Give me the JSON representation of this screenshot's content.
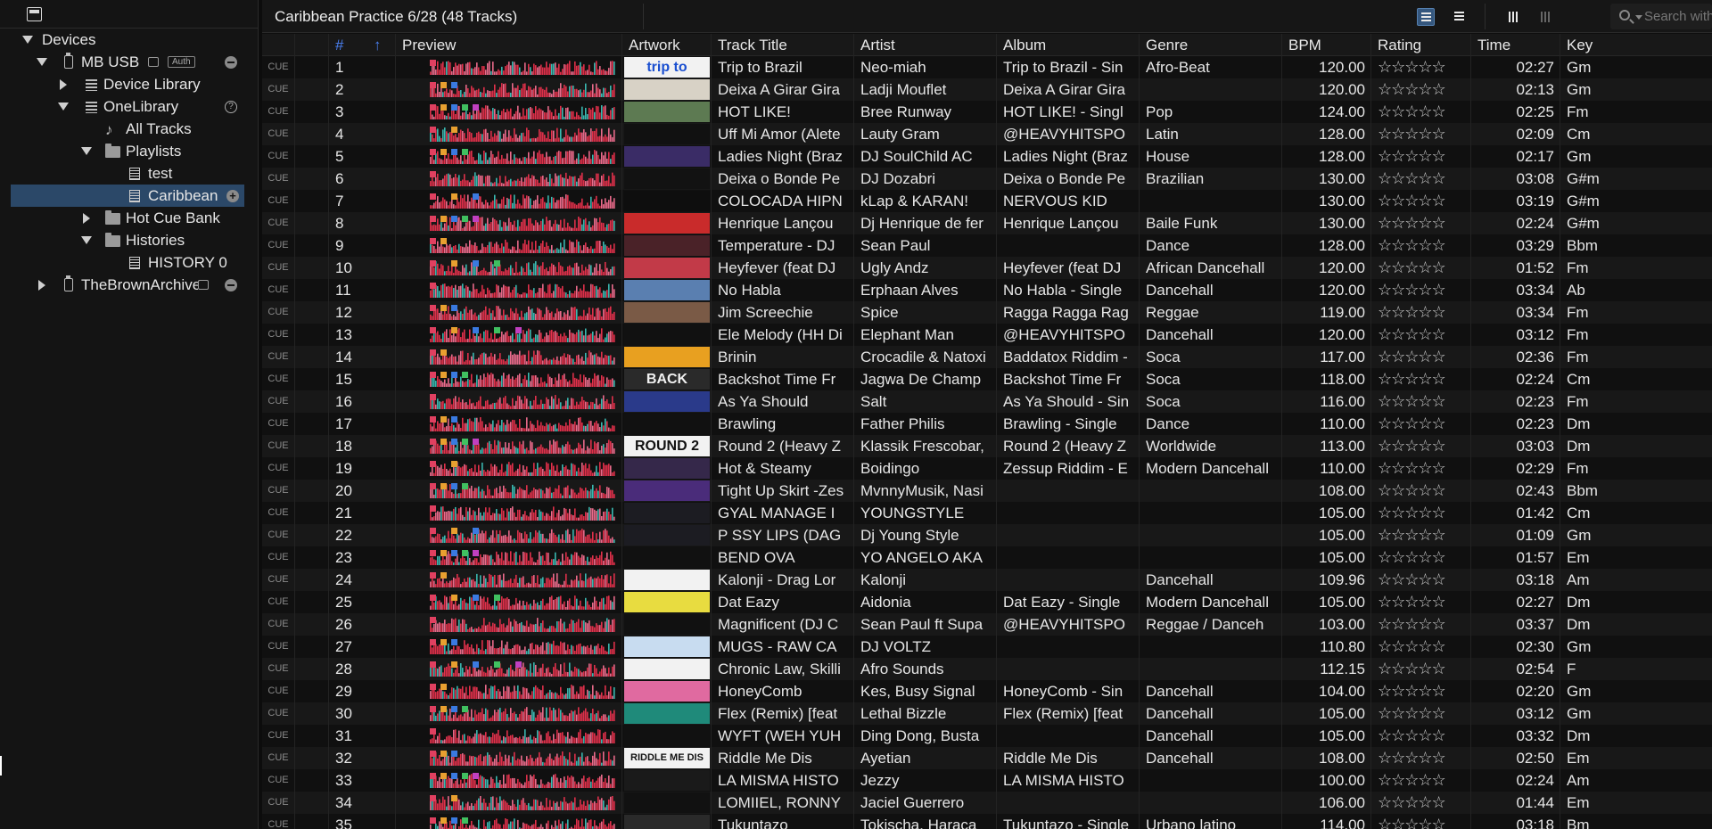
{
  "sidebar": {
    "devices": "Devices",
    "mb_usb": "MB USB",
    "auth": "Auth",
    "device_library": "Device Library",
    "onelibrary": "OneLibrary",
    "all_tracks": "All Tracks",
    "playlists": "Playlists",
    "test": "test",
    "caribbean": "Caribbean",
    "hot_cue_bank": "Hot Cue Bank",
    "histories": "Histories",
    "history0": "HISTORY 0",
    "brown_archive": "TheBrownArchive"
  },
  "header": {
    "title": "Caribbean Practice 6/28 (48 Tracks)",
    "search_placeholder": "Search with"
  },
  "columns": {
    "num": "#",
    "preview": "Preview",
    "artwork": "Artwork",
    "title": "Track Title",
    "artist": "Artist",
    "album": "Album",
    "genre": "Genre",
    "bpm": "BPM",
    "rating": "Rating",
    "time": "Time",
    "key": "Key"
  },
  "cue_label": "CUE",
  "rating_glyphs": "☆☆☆☆☆",
  "tracks": [
    {
      "n": "1",
      "title": "Trip to Brazil",
      "artist": "Neo-miah",
      "album": "Trip to Brazil - Sin",
      "genre": "Afro-Beat",
      "bpm": "120.00",
      "time": "02:27",
      "key": "Gm",
      "art": "trip to",
      "artbg": "#f2f2f2",
      "artfg": "#1a4fd0"
    },
    {
      "n": "2",
      "title": "Deixa A Girar Gira",
      "artist": "Ladji Mouflet",
      "album": "Deixa A Girar Gira",
      "genre": "",
      "bpm": "120.00",
      "time": "02:13",
      "key": "Gm",
      "art": "",
      "artbg": "#d8d2c6",
      "artfg": "#333"
    },
    {
      "n": "3",
      "title": "HOT LIKE!",
      "artist": "Bree Runway",
      "album": "HOT LIKE! - Singl",
      "genre": "Pop",
      "bpm": "124.00",
      "time": "02:25",
      "key": "Fm",
      "art": "",
      "artbg": "#5d7a52",
      "artfg": "#fff"
    },
    {
      "n": "4",
      "title": "Uff Mi Amor (Alete",
      "artist": "Lauty Gram",
      "album": "@HEAVYHITSPO",
      "genre": "Latin",
      "bpm": "128.00",
      "time": "02:09",
      "key": "Cm",
      "art": "",
      "artbg": "#111",
      "artfg": "#e03a8a"
    },
    {
      "n": "5",
      "title": "Ladies Night (Braz",
      "artist": "DJ SoulChild AC",
      "album": "Ladies Night (Braz",
      "genre": "House",
      "bpm": "128.00",
      "time": "02:17",
      "key": "Gm",
      "art": "",
      "artbg": "#3a2c66",
      "artfg": "#fff"
    },
    {
      "n": "6",
      "title": "Deixa o Bonde Pe",
      "artist": "DJ Dozabri",
      "album": "Deixa o Bonde Pe",
      "genre": "Brazilian",
      "bpm": "130.00",
      "time": "03:08",
      "key": "G#m",
      "art": "",
      "artbg": "#121212",
      "artfg": "#e03a8a"
    },
    {
      "n": "7",
      "title": "COLOCADA HIPN",
      "artist": "kLap & KARAN!",
      "album": "NERVOUS KID",
      "genre": "",
      "bpm": "130.00",
      "time": "03:19",
      "key": "G#m",
      "art": "",
      "artbg": "#0e0e0e",
      "artfg": "#fff"
    },
    {
      "n": "8",
      "title": "Henrique Lançou",
      "artist": "Dj Henrique de fer",
      "album": "Henrique Lançou",
      "genre": "Baile Funk",
      "bpm": "130.00",
      "time": "02:24",
      "key": "G#m",
      "art": "",
      "artbg": "#c92b2b",
      "artfg": "#fff"
    },
    {
      "n": "9",
      "title": "Temperature - DJ",
      "artist": "Sean Paul",
      "album": "",
      "genre": "Dance",
      "bpm": "128.00",
      "time": "03:29",
      "key": "Bbm",
      "art": "",
      "artbg": "#4a2228",
      "artfg": "#fff"
    },
    {
      "n": "10",
      "title": "Heyfever (feat DJ",
      "artist": "Ugly Andz",
      "album": "Heyfever (feat DJ",
      "genre": "African Dancehall",
      "bpm": "120.00",
      "time": "01:52",
      "key": "Fm",
      "art": "",
      "artbg": "#c23a48",
      "artfg": "#fff"
    },
    {
      "n": "11",
      "title": "No Habla",
      "artist": "Erphaan Alves",
      "album": "No Habla - Single",
      "genre": "Dancehall",
      "bpm": "120.00",
      "time": "03:34",
      "key": "Ab",
      "art": "",
      "artbg": "#5a7fb0",
      "artfg": "#fff"
    },
    {
      "n": "12",
      "title": "Jim Screechie",
      "artist": "Spice",
      "album": "Ragga Ragga Rag",
      "genre": "Reggae",
      "bpm": "119.00",
      "time": "03:34",
      "key": "Fm",
      "art": "",
      "artbg": "#7a5a46",
      "artfg": "#fff"
    },
    {
      "n": "13",
      "title": "Ele Melody (HH Di",
      "artist": "Elephant Man",
      "album": "@HEAVYHITSPO",
      "genre": "Dancehall",
      "bpm": "120.00",
      "time": "03:12",
      "key": "Fm",
      "art": "",
      "artbg": "#111",
      "artfg": "#e03a8a"
    },
    {
      "n": "14",
      "title": "Brinin",
      "artist": "Crocadile & Natoxi",
      "album": "Baddatox Riddim -",
      "genre": "Soca",
      "bpm": "117.00",
      "time": "02:36",
      "key": "Fm",
      "art": "",
      "artbg": "#e8a020",
      "artfg": "#fff"
    },
    {
      "n": "15",
      "title": "Backshot Time Fr",
      "artist": "Jagwa De Champ",
      "album": "Backshot Time Fr",
      "genre": "Soca",
      "bpm": "118.00",
      "time": "02:24",
      "key": "Cm",
      "art": "BACK",
      "artbg": "#2a2a2a",
      "artfg": "#f0f0f0"
    },
    {
      "n": "16",
      "title": "As Ya Should",
      "artist": "Salt",
      "album": "As Ya Should - Sin",
      "genre": "Soca",
      "bpm": "116.00",
      "time": "02:23",
      "key": "Fm",
      "art": "",
      "artbg": "#2a3a8a",
      "artfg": "#fff"
    },
    {
      "n": "17",
      "title": "Brawling",
      "artist": "Father Philis",
      "album": "Brawling - Single",
      "genre": "Dance",
      "bpm": "110.00",
      "time": "02:23",
      "key": "Dm",
      "art": "",
      "artbg": "#111",
      "artfg": "#e03a8a"
    },
    {
      "n": "18",
      "title": "Round 2 (Heavy Z",
      "artist": "Klassik Frescobar,",
      "album": "Round 2 (Heavy Z",
      "genre": "Worldwide",
      "bpm": "113.00",
      "time": "03:03",
      "key": "Dm",
      "art": "ROUND 2",
      "artbg": "#f2f2f2",
      "artfg": "#111"
    },
    {
      "n": "19",
      "title": "Hot & Steamy",
      "artist": "Boidingo",
      "album": "Zessup Riddim - E",
      "genre": "Modern Dancehall",
      "bpm": "110.00",
      "time": "02:29",
      "key": "Fm",
      "art": "",
      "artbg": "#35284a",
      "artfg": "#fff"
    },
    {
      "n": "20",
      "title": "Tight Up Skirt -Zes",
      "artist": "MvnnyMusik, Nasi",
      "album": "",
      "genre": "",
      "bpm": "108.00",
      "time": "02:43",
      "key": "Bbm",
      "art": "",
      "artbg": "#4a2c7a",
      "artfg": "#fff"
    },
    {
      "n": "21",
      "title": "GYAL MANAGE I",
      "artist": "YOUNGSTYLE",
      "album": "",
      "genre": "",
      "bpm": "105.00",
      "time": "01:42",
      "key": "Cm",
      "art": "",
      "artbg": "#1c1c22",
      "artfg": "#fff"
    },
    {
      "n": "22",
      "title": "P SSY LIPS (DAG",
      "artist": "Dj Young Style",
      "album": "",
      "genre": "",
      "bpm": "105.00",
      "time": "01:09",
      "key": "Gm",
      "art": "",
      "artbg": "#1c1c22",
      "artfg": "#fff"
    },
    {
      "n": "23",
      "title": "BEND OVA",
      "artist": "YO ANGELO AKA",
      "album": "",
      "genre": "",
      "bpm": "105.00",
      "time": "01:57",
      "key": "Em",
      "art": "",
      "artbg": "#111",
      "artfg": "#e03a8a"
    },
    {
      "n": "24",
      "title": "Kalonji -  Drag Lor",
      "artist": "Kalonji",
      "album": "",
      "genre": "Dancehall",
      "bpm": "109.96",
      "time": "03:18",
      "key": "Am",
      "art": "",
      "artbg": "#f2f2f2",
      "artfg": "#222"
    },
    {
      "n": "25",
      "title": "Dat Eazy",
      "artist": "Aidonia",
      "album": "Dat Eazy - Single",
      "genre": "Modern Dancehall",
      "bpm": "105.00",
      "time": "02:27",
      "key": "Dm",
      "art": "",
      "artbg": "#e8dc40",
      "artfg": "#222"
    },
    {
      "n": "26",
      "title": "Magnificent (DJ C",
      "artist": "Sean Paul ft Supa",
      "album": "@HEAVYHITSPO",
      "genre": "Reggae / Danceh",
      "bpm": "103.00",
      "time": "03:37",
      "key": "Dm",
      "art": "",
      "artbg": "#111",
      "artfg": "#e03a8a"
    },
    {
      "n": "27",
      "title": "MUGS - RAW CA",
      "artist": "DJ VOLTZ",
      "album": "",
      "genre": "",
      "bpm": "110.80",
      "time": "02:30",
      "key": "Gm",
      "art": "",
      "artbg": "#c8dcf0",
      "artfg": "#222"
    },
    {
      "n": "28",
      "title": "Chronic Law, Skilli",
      "artist": "Afro Sounds",
      "album": "",
      "genre": "",
      "bpm": "112.15",
      "time": "02:54",
      "key": "F",
      "art": "",
      "artbg": "#f2f2f2",
      "artfg": "#222"
    },
    {
      "n": "29",
      "title": "HoneyComb",
      "artist": "Kes, Busy Signal",
      "album": "HoneyComb - Sin",
      "genre": "Dancehall",
      "bpm": "104.00",
      "time": "02:20",
      "key": "Gm",
      "art": "",
      "artbg": "#e06aa0",
      "artfg": "#fff"
    },
    {
      "n": "30",
      "title": "Flex (Remix) [feat",
      "artist": "Lethal Bizzle",
      "album": "Flex (Remix) [feat",
      "genre": "Dancehall",
      "bpm": "105.00",
      "time": "03:12",
      "key": "Gm",
      "art": "",
      "artbg": "#1f8a7a",
      "artfg": "#fff"
    },
    {
      "n": "31",
      "title": "WYFT (WEH YUH",
      "artist": "Ding Dong, Busta",
      "album": "",
      "genre": "Dancehall",
      "bpm": "105.00",
      "time": "03:32",
      "key": "Dm",
      "art": "",
      "artbg": "#111",
      "artfg": "#e03a8a"
    },
    {
      "n": "32",
      "title": "Riddle Me Dis",
      "artist": "Ayetian",
      "album": "Riddle Me Dis",
      "genre": "Dancehall",
      "bpm": "108.00",
      "time": "02:50",
      "key": "Em",
      "art": "RIDDLE ME DIS",
      "artbg": "#f2f2f2",
      "artfg": "#111"
    },
    {
      "n": "33",
      "title": "LA MISMA HISTO",
      "artist": "Jezzy",
      "album": "LA MISMA HISTO",
      "genre": "",
      "bpm": "100.00",
      "time": "02:24",
      "key": "Am",
      "art": "",
      "artbg": "#1a1a1a",
      "artfg": "#fff"
    },
    {
      "n": "34",
      "title": "LOMIIEL, RONNY",
      "artist": "Jaciel Guerrero",
      "album": "",
      "genre": "",
      "bpm": "106.00",
      "time": "01:44",
      "key": "Em",
      "art": "",
      "artbg": "#111",
      "artfg": "#e03a8a"
    },
    {
      "n": "35",
      "title": "Tukuntazo",
      "artist": "Tokischa, Haraca",
      "album": "Tukuntazo - Single",
      "genre": "Urbano latino",
      "bpm": "114.00",
      "time": "03:18",
      "key": "Bm",
      "art": "",
      "artbg": "#2a2a2a",
      "artfg": "#fff"
    }
  ],
  "colors": {
    "accent": "#4a7ff0",
    "selection": "#2b4868",
    "waveform_red": "#e0304a",
    "waveform_pink": "#e86a8a",
    "waveform_teal": "#3ab8b0"
  }
}
